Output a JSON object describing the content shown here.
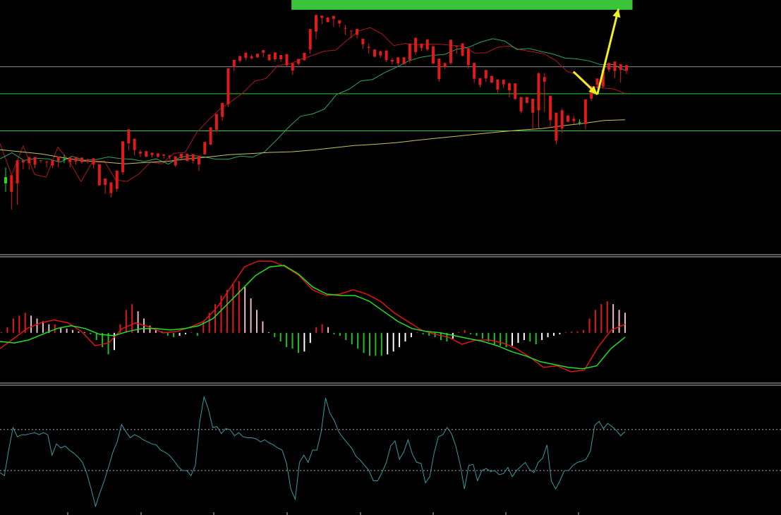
{
  "colors": {
    "background": "#000000",
    "bull": "#e11a1a",
    "bear": "#28d628",
    "ma_fast": "#b01818",
    "ma_mid": "#2aa860",
    "ma_slow": "#c8c060",
    "hline_green": "#2ed02e",
    "hline_gray": "#8a8a8a",
    "target_box": "#3ac43a",
    "arrow": "#f0f020",
    "hist_pos_dark": "#e01a1a",
    "hist_pos_light": "#f0b8c4",
    "hist_neg_dark": "#20c020",
    "hist_neg_light": "#ffffff",
    "signal_red": "#e01414",
    "signal_green": "#20e020",
    "osc": "#3a9aa0",
    "separator": "#b8b8b8",
    "dotted": "#b0b0b0"
  },
  "chart_data": [
    {
      "type": "candlestick",
      "panel": "price",
      "ylim": [
        -5,
        73
      ],
      "grid": false,
      "horizontal_levels": [
        {
          "value": 52.5,
          "style": "gray"
        },
        {
          "value": 44.2,
          "style": "green"
        },
        {
          "value": 32.8,
          "style": "green"
        }
      ],
      "target_zone": {
        "x_start": 54,
        "x_end": 118,
        "y_low": 70,
        "y_high": 73.7
      },
      "projection_arrows": [
        {
          "x": [
            107,
            111.5
          ],
          "y": [
            51,
            44
          ]
        },
        {
          "x": [
            111.5,
            115.5
          ],
          "y": [
            44,
            70.3
          ]
        }
      ],
      "candles_ohlc": [
        [
          18.6,
          16.7,
          21.6,
          14.1
        ],
        [
          14.1,
          19.2,
          17.9,
          8.6
        ],
        [
          16.7,
          23.8,
          23.1,
          10.1
        ],
        [
          23.1,
          23.8,
          24.0,
          21.0
        ],
        [
          22.9,
          24.8,
          24.7,
          20.9
        ],
        [
          22.4,
          24.8,
          23.9,
          21.3
        ],
        [
          23.6,
          23.8,
          23.7,
          23.0
        ],
        [
          23.2,
          23.3,
          23.7,
          21.6
        ],
        [
          22.2,
          23.8,
          23.9,
          21.4
        ],
        [
          23.5,
          24.9,
          24.8,
          21.6
        ],
        [
          24.2,
          24.1,
          25.5,
          22.9
        ],
        [
          23.2,
          24.6,
          24.6,
          21.6
        ],
        [
          23.4,
          24.8,
          24.7,
          22.4
        ],
        [
          23.2,
          24.6,
          23.5,
          22.7
        ],
        [
          23.3,
          24.0,
          24.3,
          22.8
        ],
        [
          22.5,
          24.4,
          23.8,
          21.3
        ],
        [
          16.1,
          22.6,
          21.9,
          15.9
        ],
        [
          16.2,
          18.2,
          17.5,
          13.5
        ],
        [
          13.7,
          17.0,
          16.2,
          12.4
        ],
        [
          15.0,
          20.6,
          19.4,
          14.1
        ],
        [
          20.1,
          29.6,
          28.4,
          19.3
        ],
        [
          28.9,
          33.3,
          28.6,
          26.8
        ],
        [
          26.9,
          30.4,
          29.3,
          25.2
        ],
        [
          25.8,
          26.4,
          27.0,
          24.7
        ],
        [
          24.9,
          26.6,
          25.0,
          24.7
        ],
        [
          25.4,
          26.1,
          25.9,
          24.7
        ],
        [
          24.9,
          25.9,
          25.4,
          24.5
        ],
        [
          25.2,
          25.6,
          25.2,
          24.3
        ],
        [
          24.8,
          25.2,
          25.3,
          24.1
        ],
        [
          22.2,
          25.0,
          24.8,
          21.7
        ],
        [
          24.4,
          25.8,
          25.0,
          24.1
        ],
        [
          23.5,
          25.8,
          25.3,
          23.5
        ],
        [
          23.6,
          25.7,
          24.5,
          22.8
        ],
        [
          22.5,
          25.2,
          23.7,
          20.5
        ],
        [
          25.6,
          29.4,
          28.2,
          25.5
        ],
        [
          28.6,
          33.9,
          32.3,
          28.4
        ],
        [
          33.1,
          38.0,
          37.4,
          32.3
        ],
        [
          37.1,
          41.4,
          40.8,
          35.9
        ],
        [
          41.0,
          52.0,
          51.5,
          40.2
        ],
        [
          52.4,
          54.6,
          53.8,
          51.1
        ],
        [
          54.3,
          55.8,
          55.6,
          53.7
        ],
        [
          55.2,
          56.8,
          56.8,
          54.5
        ],
        [
          55.1,
          55.7,
          56.3,
          54.8
        ],
        [
          55.4,
          56.5,
          56.1,
          55.2
        ],
        [
          56.8,
          57.6,
          57.4,
          55.4
        ],
        [
          54.5,
          56.3,
          55.6,
          54.3
        ],
        [
          54.8,
          56.9,
          56.3,
          54.1
        ],
        [
          54.8,
          56.1,
          55.6,
          54.0
        ],
        [
          53.0,
          56.4,
          56.0,
          52.6
        ],
        [
          51.3,
          53.6,
          53.6,
          50.0
        ],
        [
          53.4,
          54.9,
          54.9,
          52.9
        ],
        [
          54.5,
          56.8,
          56.3,
          54.4
        ],
        [
          57.8,
          64.1,
          63.9,
          56.5
        ],
        [
          63.3,
          68.4,
          67.0,
          61.0
        ],
        [
          67.5,
          68.2,
          67.9,
          65.6
        ],
        [
          66.2,
          67.6,
          67.8,
          66.2
        ],
        [
          67.2,
          68.1,
          67.5,
          64.7
        ],
        [
          65.8,
          66.8,
          66.6,
          64.7
        ],
        [
          64.3,
          64.4,
          65.3,
          62.3
        ],
        [
          63.6,
          63.6,
          63.4,
          61.3
        ],
        [
          62.3,
          64.1,
          63.3,
          61.2
        ],
        [
          59.4,
          61.1,
          60.4,
          58.0
        ],
        [
          58.3,
          58.6,
          59.6,
          56.5
        ],
        [
          55.6,
          57.8,
          57.6,
          55.3
        ],
        [
          56.0,
          57.3,
          56.4,
          55.3
        ],
        [
          54.5,
          57.5,
          57.4,
          53.9
        ],
        [
          54.1,
          54.6,
          55.3,
          53.2
        ],
        [
          53.5,
          55.4,
          55.1,
          52.8
        ],
        [
          53.3,
          55.4,
          55.1,
          53.2
        ],
        [
          54.6,
          59.6,
          59.4,
          53.6
        ],
        [
          57.0,
          61.4,
          60.5,
          56.2
        ],
        [
          58.3,
          59.6,
          59.6,
          57.3
        ],
        [
          57.8,
          60.9,
          60.1,
          57.2
        ],
        [
          53.5,
          58.8,
          57.4,
          53.3
        ],
        [
          48.7,
          55.0,
          52.8,
          47.9
        ],
        [
          52.4,
          53.6,
          53.8,
          51.8
        ],
        [
          53.6,
          60.8,
          60.4,
          53.1
        ],
        [
          58.8,
          58.9,
          58.9,
          56.5
        ],
        [
          55.9,
          59.7,
          59.6,
          55.7
        ],
        [
          53.0,
          58.2,
          55.9,
          51.9
        ],
        [
          48.8,
          53.7,
          52.5,
          47.5
        ],
        [
          46.9,
          49.0,
          49.0,
          46.1
        ],
        [
          48.9,
          51.5,
          50.8,
          47.8
        ],
        [
          47.6,
          49.7,
          49.1,
          47.6
        ],
        [
          45.5,
          48.6,
          48.2,
          44.5
        ],
        [
          47.1,
          48.5,
          48.3,
          45.9
        ],
        [
          45.3,
          47.4,
          47.8,
          43.1
        ],
        [
          42.6,
          47.4,
          47.1,
          42.3
        ],
        [
          38.8,
          43.2,
          40.8,
          38.2
        ],
        [
          41.4,
          43.2,
          41.9,
          41.2
        ],
        [
          38.4,
          42.7,
          42.1,
          33.5
        ],
        [
          39.1,
          50.5,
          50.8,
          33.5
        ],
        [
          47.9,
          49.3,
          50.6,
          38.6
        ],
        [
          36.1,
          43.6,
          43.5,
          33.7
        ],
        [
          29.8,
          38.4,
          38.4,
          28.6
        ],
        [
          33.5,
          39.1,
          39.7,
          32.2
        ],
        [
          35.6,
          37.5,
          37.9,
          35.4
        ],
        [
          35.8,
          36.5,
          37.4,
          34.8
        ],
        [
          35.5,
          35.4,
          36.4,
          34.6
        ],
        [
          34.9,
          42.5,
          41.3,
          33.3
        ],
        [
          42.7,
          46.5,
          46.3,
          42.0
        ],
        [
          47.0,
          48.9,
          47.8,
          45.9
        ],
        [
          46.4,
          51.6,
          51.0,
          45.9
        ],
        [
          51.6,
          53.7,
          53.3,
          50.9
        ],
        [
          51.2,
          54.1,
          54.1,
          49.0
        ],
        [
          51.5,
          53.3,
          53.3,
          47.6
        ],
        [
          51.2,
          53.0,
          51.1,
          50.2
        ]
      ],
      "moving_averages": [
        {
          "style": "fast",
          "values": [
            28.9,
            19.2,
            28.2,
            19.4,
            18.6,
            27.8,
            23.4,
            17.2,
            23.4,
            23.6,
            17.7,
            17.3,
            19.6,
            23.2,
            22.7,
            25.9,
            26.2,
            32.3,
            36.1,
            39.5,
            41.9,
            44.5,
            48.1,
            48.9,
            52.9,
            53.3,
            54.8,
            56.0,
            57.3,
            57.6,
            60.7,
            63.5,
            64.5,
            62.6,
            59.0,
            59.6,
            59.3,
            59.4,
            59.4,
            59.1,
            58.8,
            56.7,
            56.8,
            58.5,
            58.9,
            57.7,
            57.1,
            56.5,
            54.4,
            51.1,
            49.8,
            46.5,
            46.0,
            45.7,
            44.3
          ]
        },
        {
          "style": "mid",
          "values": [
            24.2,
            26.1,
            23.7,
            24.4,
            24.2,
            23.2,
            25.0,
            23.8,
            24.0,
            24.8,
            24.3,
            24.1,
            23.4,
            24.2,
            22.6,
            24.7,
            25.3,
            24.8,
            24.1,
            24.1,
            25.1,
            24.7,
            26.3,
            30.0,
            33.9,
            37.3,
            38.0,
            39.5,
            44.0,
            45.5,
            48.1,
            48.6,
            50.7,
            52.4,
            54.3,
            55.4,
            56.0,
            56.3,
            57.9,
            58.5,
            60.1,
            61.1,
            60.4,
            57.8,
            58.1,
            57.2,
            56.4,
            55.2,
            54.9,
            54.3,
            53.1,
            53.2,
            51.4
          ]
        },
        {
          "style": "slow",
          "values": [
            27.0,
            26.4,
            25.7,
            24.6,
            23.6,
            23.2,
            22.7,
            23.1,
            23.4,
            24.2,
            24.8,
            25.5,
            25.8,
            26.2,
            26.4,
            26.9,
            27.6,
            28.3,
            28.7,
            29.2,
            29.9,
            30.6,
            31.2,
            31.9,
            32.5,
            33.1,
            33.5,
            34.4,
            35.1,
            36.0,
            36.2
          ]
        }
      ]
    },
    {
      "type": "histogram_with_lines",
      "panel": "macd",
      "ylim": [
        -1.7,
        2.6
      ],
      "zero_level": 0,
      "histogram": [
        0.0,
        0.2,
        0.5,
        0.6,
        0.7,
        0.6,
        0.5,
        0.4,
        0.3,
        0.3,
        0.2,
        0.15,
        0.1,
        0.05,
        0.0,
        -0.05,
        -0.25,
        -0.5,
        -0.75,
        -0.6,
        0.3,
        0.8,
        1.0,
        0.75,
        0.5,
        0.25,
        0.1,
        0.05,
        -0.1,
        -0.15,
        -0.1,
        -0.05,
        0.0,
        -0.1,
        0.4,
        0.7,
        1.0,
        1.3,
        1.5,
        1.7,
        1.8,
        1.6,
        1.2,
        0.8,
        0.4,
        0.0,
        -0.15,
        -0.3,
        -0.5,
        -0.55,
        -0.7,
        -0.65,
        -0.35,
        0.2,
        0.3,
        0.2,
        -0.05,
        -0.1,
        -0.25,
        -0.4,
        -0.55,
        -0.7,
        -0.8,
        -0.8,
        -0.8,
        -0.75,
        -0.65,
        -0.5,
        -0.3,
        -0.15,
        0.0,
        -0.05,
        -0.1,
        -0.15,
        -0.25,
        -0.3,
        -0.2,
        0.0,
        0.1,
        -0.05,
        -0.1,
        -0.2,
        -0.3,
        -0.4,
        -0.45,
        -0.5,
        -0.45,
        -0.35,
        -0.25,
        -0.3,
        -0.4,
        -0.25,
        -0.15,
        -0.1,
        -0.05,
        0.0,
        0.05,
        0.05,
        0.1,
        0.5,
        0.8,
        1.0,
        1.1,
        1.0,
        0.8,
        0.7
      ],
      "line_red": [
        -0.55,
        -0.2,
        0.15,
        0.35,
        0.45,
        0.35,
        0.05,
        -0.45,
        -0.35,
        0.15,
        0.35,
        0.2,
        0.0,
        0.05,
        0.2,
        0.4,
        0.9,
        1.6,
        2.3,
        2.5,
        2.5,
        2.3,
        2.0,
        1.5,
        1.3,
        1.35,
        1.5,
        1.35,
        1.1,
        0.7,
        0.4,
        0.1,
        -0.05,
        -0.15,
        -0.4,
        -0.25,
        -0.25,
        -0.35,
        -0.55,
        -0.85,
        -1.2,
        -1.15,
        -1.35,
        -1.3,
        -0.5,
        0.1,
        0.3
      ],
      "line_green": [
        -0.3,
        -0.35,
        -0.25,
        -0.05,
        0.15,
        0.25,
        0.15,
        -0.05,
        -0.1,
        0.05,
        0.15,
        0.15,
        0.1,
        0.15,
        0.25,
        0.5,
        1.0,
        1.5,
        2.0,
        2.3,
        2.35,
        2.05,
        1.6,
        1.35,
        1.3,
        1.3,
        1.1,
        0.75,
        0.4,
        0.15,
        0.05,
        0.0,
        -0.1,
        -0.2,
        -0.3,
        -0.45,
        -0.65,
        -0.8,
        -1.0,
        -1.1,
        -1.2,
        -1.25,
        -1.15,
        -0.55,
        -0.15
      ]
    },
    {
      "type": "line",
      "panel": "oscillator",
      "ylim": [
        -10,
        112
      ],
      "levels": [
        70,
        30
      ],
      "values": [
        28,
        25,
        50,
        72,
        63,
        65,
        65,
        66,
        67,
        65,
        67,
        65,
        45,
        56,
        52,
        54,
        50,
        47,
        43,
        38,
        27,
        12,
        -5,
        8,
        20,
        33,
        48,
        58,
        75,
        68,
        62,
        65,
        63,
        60,
        58,
        56,
        55,
        50,
        48,
        45,
        40,
        34,
        30,
        30,
        25,
        35,
        77,
        102,
        90,
        72,
        73,
        66,
        71,
        70,
        64,
        67,
        63,
        62,
        62,
        61,
        58,
        60,
        57,
        55,
        52,
        50,
        37,
        12,
        2,
        38,
        45,
        38,
        50,
        50,
        68,
        101,
        86,
        79,
        68,
        62,
        57,
        52,
        44,
        40,
        35,
        30,
        20,
        20,
        28,
        38,
        54,
        59,
        41,
        48,
        60,
        46,
        38,
        37,
        18,
        24,
        47,
        63,
        65,
        72,
        66,
        54,
        36,
        12,
        35,
        36,
        20,
        30,
        32,
        29,
        30,
        26,
        27,
        33,
        24,
        30,
        34,
        38,
        31,
        28,
        38,
        42,
        55,
        20,
        12,
        20,
        30,
        30,
        35,
        38,
        39,
        41,
        49,
        74,
        78,
        71,
        76,
        73,
        69,
        64,
        68
      ]
    }
  ]
}
